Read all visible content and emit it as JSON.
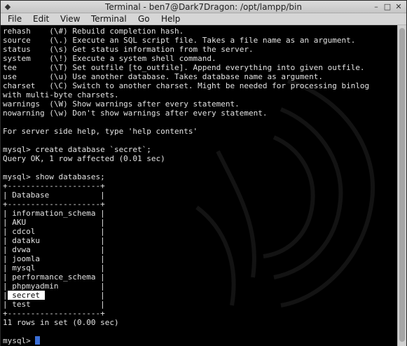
{
  "window": {
    "title": "Terminal - ben7@Dark7Dragon: /opt/lampp/bin",
    "minimize_glyph": "–",
    "maximize_glyph": "□",
    "close_glyph": "✕",
    "menu_glyph": "◆"
  },
  "menubar": {
    "items": [
      "File",
      "Edit",
      "View",
      "Terminal",
      "Go",
      "Help"
    ]
  },
  "terminal": {
    "lines": [
      "rehash    (\\#) Rebuild completion hash.",
      "source    (\\.) Execute an SQL script file. Takes a file name as an argument.",
      "status    (\\s) Get status information from the server.",
      "system    (\\!) Execute a system shell command.",
      "tee       (\\T) Set outfile [to_outfile]. Append everything into given outfile.",
      "use       (\\u) Use another database. Takes database name as argument.",
      "charset   (\\C) Switch to another charset. Might be needed for processing binlog",
      "with multi-byte charsets.",
      "warnings  (\\W) Show warnings after every statement.",
      "nowarning (\\w) Don't show warnings after every statement.",
      "",
      "For server side help, type 'help contents'",
      "",
      "mysql> create database `secret`;",
      "Query OK, 1 row affected (0.01 sec)",
      "",
      "mysql> show databases;",
      "+--------------------+",
      "| Database           |",
      "+--------------------+",
      "| information_schema |",
      "| AKU                |",
      "| cdcol              |",
      "| dataku             |",
      "| dvwa               |",
      "| joomla             |",
      "| mysql              |",
      "| performance_schema |",
      "| phpmyadmin         |",
      "|",
      "| test               |",
      "+--------------------+",
      "11 rows in set (0.00 sec)",
      "",
      "mysql> "
    ],
    "highlight_line": {
      "index": 29,
      "selected_text": " secret ",
      "rest": "            |"
    },
    "prompt_line_index": 34,
    "cursor_color": "#3b6fd6"
  }
}
